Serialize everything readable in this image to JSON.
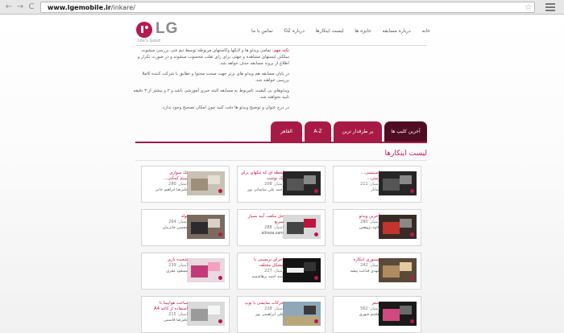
{
  "browser": {
    "url_host": "www.lgemobile.ir",
    "url_path": "/inkare/",
    "back_glyph": "←",
    "forward_glyph": "→",
    "reload_glyph": "C",
    "star_glyph": "☆"
  },
  "brand": {
    "name": "LG",
    "tagline": "Life's Good"
  },
  "nav": [
    "خانه",
    "درباره مسابقه",
    "جایزه ها",
    "لیست اینکارها",
    "درباره G2",
    "تماس با ما"
  ],
  "rules": {
    "note_label": "نکته مهم:",
    "paragraphs": [
      "تمامی ویدئو ها و لایکها وکامنتهای مربوطه توسط تیم فنی بررسی میشوند. سلکتن لیستهای مشاهده و جهتی برای رای تقلب محسوب میشوند و در صورت تکرار و اطلاع از بروند مسابقه حذف خواهد شد.",
      "در پایان مسابقه هم ویدئو های برتر جهت صحت محتوا و تطابق با شرکت کننده کاملا بررسی خواهند شد.",
      "ویدئوهای بی کیفیت تامربوط به مسابقه البته خبری آموزشی باشد و ۲ و بیشتر از ۳ دقیقه تایید نخواهند شد.",
      "در درج عنوان و توضیح ویدئو ها دقت کنید چون امکان تصحیح وجود ندارد."
    ]
  },
  "tabs": [
    "آخرین کلیپ ها",
    "پر طرفدار ترین",
    "A-Z",
    "القاهر"
  ],
  "section_title": "لیست اینکارها",
  "cards": [
    {
      "title": "استیسی...",
      "title2": "آمدن...",
      "score": "امتیاز: 211",
      "author": "ساناز"
    },
    {
      "title": "لحظه ای که تیکهای برای",
      "title2": "یک نوشت",
      "score": "امتیاز: 208",
      "author": "احمد علی ساسانی پور"
    },
    {
      "title": "تک سواری",
      "title2": "بیبیم کمکتی...",
      "score": "امتیاز: 280",
      "author": "علیرضا ابراهیم خانی"
    },
    {
      "title": "آخرین ویدئو",
      "title2": "",
      "score": "امتیاز: 280",
      "author": "کاوه پژوهش"
    },
    {
      "title": "حل مکعب آینه بسیار",
      "title2": "سریع",
      "score": "امتیاز: 288",
      "author": "alireza.sam"
    },
    {
      "title": "تولد",
      "title2": "",
      "score": "امتیاز: 264",
      "author": "محسن خانزنیان"
    },
    {
      "title": "سنتوری انتکاره",
      "title2": "",
      "score": "امتیاز: 242",
      "author": "مهدی قناعت پیشه"
    },
    {
      "title": "اجرای نرمسنی با",
      "title2": "مشکل مختلف",
      "score": "امتیاز: 227",
      "author": "سید احمد پرهاشمیه"
    },
    {
      "title": "شعبده بازی",
      "title2": "",
      "score": "امتیاز: 239",
      "author": "مسعود مقری"
    },
    {
      "title": "شعر",
      "title2": "",
      "score": "امتیاز: 562",
      "author": "هاشم شهری"
    },
    {
      "title": "حرکات نمایشی با توپ",
      "title2": "",
      "score": "امتیاز: 228",
      "author": "علی ابراهیمی پور"
    },
    {
      "title": "ساخت هواپیما با",
      "title2": "استفاده از کاغذ A4",
      "score": "امتیاز: 215",
      "author": "علیرضا قاسمی"
    }
  ],
  "colors": {
    "brand": "#a81a45",
    "brand_dark": "#4f0c23",
    "accent_text": "#c0143c"
  }
}
